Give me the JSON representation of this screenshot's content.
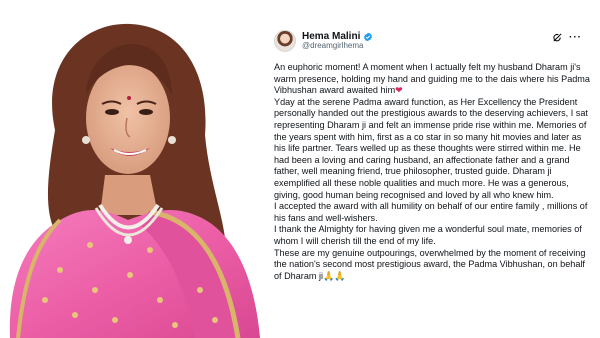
{
  "photo": {
    "alt": ""
  },
  "post": {
    "author_name": "Hema Malini",
    "handle": "@dreamgirlhema",
    "paragraphs": [
      "An euphoric moment! A moment when I actually felt my husband Dharam ji's warm presence, holding my hand and guiding me to the dais where his Padma Vibhushan award awaited him",
      "Yday at the serene Padma award function, as Her Excellency the President personally handed out the prestigious awards to the deserving achievers, I sat representing Dharam ji and felt an immense pride rise within me. Memories of the years spent with him, first as a co star in so many hit movies and later as his life partner. Tears welled up as these thoughts were stirred within me. He had been a loving and caring husband, an affectionate  father and a grand father, well meaning friend, true philosopher, trusted guide. Dharam ji exemplified all these noble qualities and much more. He was a generous, giving, good human being recognised and loved by all who knew him.",
      "I accepted the award with all humility on behalf of our entire family , millions of his fans and well-wishers.",
      "I thank the Almighty for having given me a wonderful soul mate, memories of whom I will cherish till the end of my life.",
      "These are my genuine outpourings, overwhelmed by the moment of receiving the nation's second most prestigious award, the Padma Vibhushan, on behalf of Dharam ji"
    ],
    "heart_emoji": "❤",
    "pray_emoji": "🙏🙏"
  },
  "colors": {
    "verified": "#1d9bf0",
    "saree_pink": "#ec5fa7",
    "text": "#0f1419",
    "secondary": "#536471"
  },
  "icons": [
    "verified-badge-icon",
    "grok-icon",
    "more-options-icon"
  ]
}
